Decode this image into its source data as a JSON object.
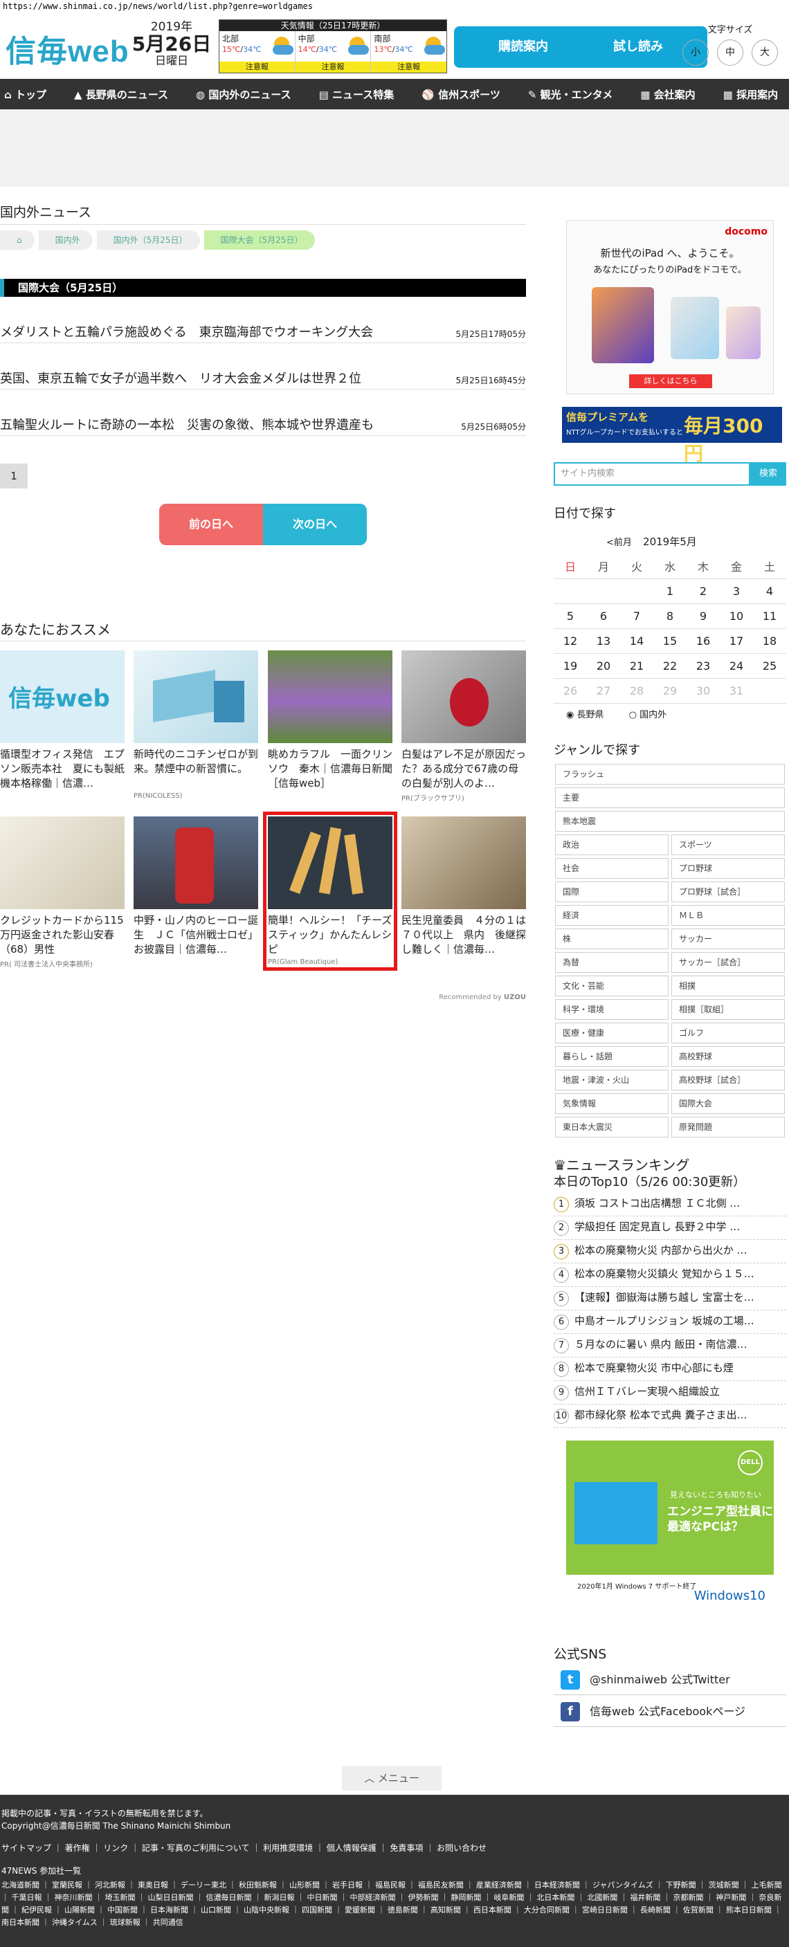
{
  "browser": {
    "url": "https://www.shinmai.co.jp/news/world/list.php?genre=worldgames"
  },
  "header": {
    "logo": "信毎web",
    "date": {
      "year": "2019年",
      "day": "5月26日",
      "weekday": "日曜日"
    },
    "weather": {
      "title": "天気情報（25日17時更新）",
      "regions": [
        {
          "name": "北部",
          "hi": "15℃",
          "lo": "34℃",
          "warning": "注意報"
        },
        {
          "name": "中部",
          "hi": "14℃",
          "lo": "34℃",
          "warning": "注意報"
        },
        {
          "name": "南部",
          "hi": "13℃",
          "lo": "34℃",
          "warning": "注意報"
        }
      ]
    },
    "buttons": {
      "subscribe": "購読案内",
      "trial": "試し読み"
    },
    "font_size": {
      "label": "文字サイズ",
      "small": "小",
      "medium": "中",
      "large": "大"
    }
  },
  "nav": [
    "トップ",
    "長野県のニュース",
    "国内外のニュース",
    "ニュース特集",
    "信州スポーツ",
    "観光・エンタメ",
    "会社案内",
    "採用案内"
  ],
  "main": {
    "section_title": "国内外ニュース",
    "breadcrumb": [
      "国内外",
      "国内外（5月25日）",
      "国際大会（5月25日）"
    ],
    "category_bar": "国際大会（5月25日）",
    "articles": [
      {
        "title": "メダリストと五輪パラ施設めぐる　東京臨海部でウオーキング大会",
        "time": "5月25日17時05分"
      },
      {
        "title": "英国、東京五輪で女子が過半数へ　リオ大会金メダルは世界２位",
        "time": "5月25日16時45分"
      },
      {
        "title": "五輪聖火ルートに奇跡の一本松　災害の象徴、熊本城や世界遺産も",
        "time": "5月25日6時05分"
      }
    ],
    "pager": "1",
    "prev": "前の日へ",
    "next": "次の日へ",
    "recommend_title": "あなたにおススメ",
    "recommend": [
      {
        "text": "循環型オフィス発信　エプソン販売本社　夏にも製紙機本格稼働｜信濃…",
        "src": ""
      },
      {
        "text": "新時代のニコチンゼロが到来。禁煙中の新習慣に。",
        "src": "PR(NICOLESS)"
      },
      {
        "text": "眺めカラフル　一面クリンソウ　秦木｜信濃毎日新聞［信毎web］",
        "src": ""
      },
      {
        "text": "白髪はアレ不足が原因だった？ある成分で67歳の母の白髪が別人のよ…",
        "src": "PR(ブラックサプリ)"
      },
      {
        "text": "クレジットカードから115万円返金された影山安春（68）男性",
        "src": "PR( 司法書士法人中央事務所)"
      },
      {
        "text": "中野・山ノ内のヒーロー誕生　ＪＣ「信州戦士ロゼ」お披露目｜信濃毎…",
        "src": ""
      },
      {
        "text": "簡単！ヘルシー！「チーズスティック」かんたんレシピ",
        "src": "PR(Glam Beautique)"
      },
      {
        "text": "民生児童委員　４分の１は７０代以上　県内　後継探し難しく｜信濃毎…",
        "src": ""
      }
    ],
    "recommended_by": "Recommended by"
  },
  "sidebar": {
    "ad1": {
      "brand": "docomo",
      "line1": "新世代のiPad へ、ようこそ。",
      "line2": "あなたにぴったりのiPadをドコモで。",
      "button": "詳しくはこちら"
    },
    "ad2": {
      "line1": "信毎プレミアムを",
      "line2": "NTTグループカードでお支払いすると",
      "amount": "毎月300円"
    },
    "search": {
      "placeholder": "サイト内検索",
      "button": "検索"
    },
    "calendar": {
      "title": "日付で探す",
      "prev": "<前月",
      "month": "2019年5月",
      "weekdays": [
        "日",
        "月",
        "火",
        "水",
        "木",
        "金",
        "土"
      ],
      "weeks": [
        [
          "",
          "",
          "",
          "1",
          "2",
          "3",
          "4"
        ],
        [
          "5",
          "6",
          "7",
          "8",
          "9",
          "10",
          "11"
        ],
        [
          "12",
          "13",
          "14",
          "15",
          "16",
          "17",
          "18"
        ],
        [
          "19",
          "20",
          "21",
          "22",
          "23",
          "24",
          "25"
        ],
        [
          "26",
          "27",
          "28",
          "29",
          "30",
          "31",
          ""
        ]
      ],
      "radio1": "長野県",
      "radio2": "国内外"
    },
    "genre_title": "ジャンルで探す",
    "genres": [
      [
        "フラッシュ"
      ],
      [
        "主要"
      ],
      [
        "熊本地震"
      ],
      [
        "政治",
        "スポーツ"
      ],
      [
        "社会",
        "プロ野球"
      ],
      [
        "国際",
        "プロ野球［試合］"
      ],
      [
        "経済",
        "ＭＬＢ"
      ],
      [
        "株",
        "サッカー"
      ],
      [
        "為替",
        "サッカー［試合］"
      ],
      [
        "文化・芸能",
        "相撲"
      ],
      [
        "科学・環境",
        "相撲［取組］"
      ],
      [
        "医療・健康",
        "ゴルフ"
      ],
      [
        "暮らし・話題",
        "高校野球"
      ],
      [
        "地震・津波・火山",
        "高校野球［試合］"
      ],
      [
        "気象情報",
        "国際大会"
      ],
      [
        "東日本大震災",
        "原発問題"
      ]
    ],
    "ranking_title": "ニュースランキング",
    "ranking_sub": "本日のTop10（5/26 00:30更新）",
    "ranking": [
      "須坂 コストコ出店構想 ＩＣ北側 …",
      "学級担任 固定見直し 長野２中学 …",
      "松本の廃棄物火災 内部から出火か …",
      "松本の廃棄物火災鎮火 覚知から１５…",
      "【速報】御嶽海は勝ち越し 宝富士を…",
      "中島オールプリシジョン 坂城の工場…",
      "５月なのに暑い 県内 飯田・南信濃…",
      "松本で廃棄物火災 市中心部にも煙",
      "信州ＩＴバレー実現へ組織設立",
      "都市緑化祭 松本で式典 糞子さま出…"
    ],
    "ad3": {
      "brand": "DELL",
      "line1": "見えないところも知りたい",
      "line2": "エンジニア型社員に最適なPCは？",
      "foot": "2020年1月 Windows 7 サポート終了",
      "win": "Windows10"
    },
    "sns_title": "公式SNS",
    "twitter": "@shinmaiweb 公式Twitter",
    "facebook": "信毎web 公式Facebookページ"
  },
  "menu_button": "メニュー",
  "footer": {
    "notice": "掲載中の記事・写真・イラストの無断転用を禁じます。",
    "copyright": "Copyright@信濃毎日新聞 The Shinano Mainichi Shimbun",
    "links": "サイトマップ ｜ 著作権 ｜ リンク ｜ 記事・写真のご利用について ｜ 利用推奨環境 ｜ 個人情報保護 ｜ 免責事項 ｜ お問い合わせ",
    "papers_title": "47NEWS 参加社一覧",
    "papers": "北海道新聞 ｜ 室蘭民報 ｜ 河北新報 ｜ 東奥日報 ｜ デーリー東北 ｜ 秋田魁新報 ｜ 山形新聞 ｜ 岩手日報 ｜ 福島民報 ｜ 福島民友新聞 ｜ 産業経済新聞 ｜ 日本経済新聞 ｜ ジャパンタイムズ ｜ 下野新聞 ｜ 茨城新聞 ｜ 上毛新聞 ｜ 千葉日報 ｜ 神奈川新聞 ｜ 埼玉新聞 ｜ 山梨日日新聞 ｜ 信濃毎日新聞 ｜ 新潟日報 ｜ 中日新聞 ｜ 中部経済新聞 ｜ 伊勢新聞 ｜ 静岡新聞 ｜ 岐阜新聞 ｜ 北日本新聞 ｜ 北國新聞 ｜ 福井新聞 ｜ 京都新聞 ｜ 神戸新聞 ｜ 奈良新聞 ｜ 紀伊民報 ｜ 山陽新聞 ｜ 中国新聞 ｜ 日本海新聞 ｜ 山口新聞 ｜ 山陰中央新報 ｜ 四国新聞 ｜ 愛媛新聞 ｜ 徳島新聞 ｜ 高知新聞 ｜ 西日本新聞 ｜ 大分合同新聞 ｜ 宮崎日日新聞 ｜ 長崎新聞 ｜ 佐賀新聞 ｜ 熊本日日新聞 ｜ 南日本新聞 ｜ 沖縄タイムス ｜ 琉球新報 ｜ 共同通信"
  }
}
